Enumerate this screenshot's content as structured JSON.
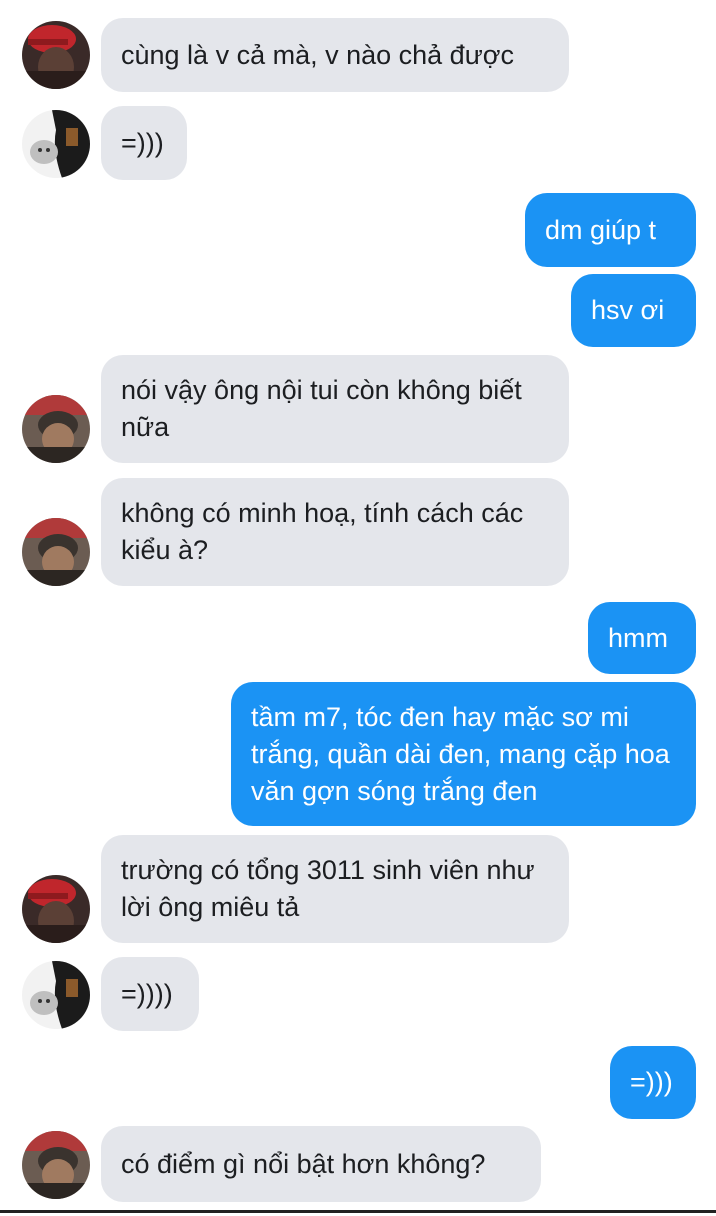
{
  "messages": [
    {
      "side": "in",
      "avatar": "red-cap",
      "text": "cùng là v cả mà, v nào chả được"
    },
    {
      "side": "in",
      "avatar": "cat",
      "text": "=)))"
    },
    {
      "side": "out",
      "text": "dm giúp t"
    },
    {
      "side": "out",
      "text": "hsv ơi"
    },
    {
      "side": "in",
      "avatar": "beanie",
      "text": "nói vậy ông nội tui còn không biết nữa"
    },
    {
      "side": "in",
      "avatar": "beanie",
      "text": "không có minh hoạ, tính cách các kiểu à?"
    },
    {
      "side": "out",
      "text": "hmm"
    },
    {
      "side": "out",
      "text": "tầm m7, tóc đen hay mặc sơ mi trắng, quần dài đen, mang cặp hoa văn gợn sóng trắng đen"
    },
    {
      "side": "in",
      "avatar": "red-cap",
      "text": "trường có tổng 3011 sinh viên như lời ông miêu tả"
    },
    {
      "side": "in",
      "avatar": "cat",
      "text": "=))))"
    },
    {
      "side": "out",
      "text": "=)))"
    },
    {
      "side": "in",
      "avatar": "beanie",
      "text": "có điểm gì nổi bật hơn không?"
    }
  ],
  "colors": {
    "outgoing": "#1b93f4",
    "incoming": "#e4e6eb"
  }
}
